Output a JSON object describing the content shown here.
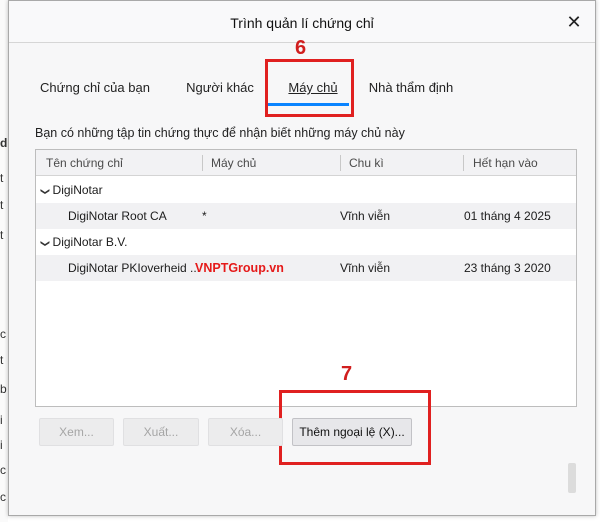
{
  "background_page": {
    "letters": [
      "d",
      "t",
      "t",
      "t",
      "c",
      "t",
      "b",
      "i",
      "i",
      "c",
      "c"
    ]
  },
  "dialog": {
    "title": "Trình quản lí chứng chỉ",
    "close_symbol": "✕"
  },
  "tabs": [
    {
      "label": "Chứng chỉ của bạn",
      "selected": false
    },
    {
      "label": "Người khác",
      "selected": false
    },
    {
      "label": "Máy chủ",
      "selected": true
    },
    {
      "label": "Nhà thẩm định",
      "selected": false
    }
  ],
  "annotations": {
    "step_tab": "6",
    "step_button": "7",
    "watermark": "VNPTGroup.vn",
    "highlight_color": "#e02020"
  },
  "description": "Bạn có những tập tin chứng thực để nhận biết những máy chủ này",
  "table": {
    "columns": [
      "Tên chứng chỉ",
      "Máy chủ",
      "Chu kì",
      "Hết hạn vào"
    ],
    "groups": [
      {
        "name": "DigiNotar",
        "expand_icon": "chevron-down-icon",
        "rows": [
          {
            "name": "DigiNotar Root CA",
            "server": "*",
            "lifetime": "Vĩnh viễn",
            "expires": "01 tháng 4 2025"
          }
        ]
      },
      {
        "name": "DigiNotar B.V.",
        "expand_icon": "chevron-down-icon",
        "rows": [
          {
            "name": "DigiNotar PKIoverheid ...",
            "server": "",
            "lifetime": "Vĩnh viễn",
            "expires": "23 tháng 3 2020"
          }
        ]
      }
    ]
  },
  "buttons": {
    "view": "Xem...",
    "export": "Xuất...",
    "delete": "Xóa...",
    "add_exception": "Thêm ngoại lệ (X)..."
  },
  "colors": {
    "accent": "#0a84ff",
    "annotation": "#d11e1e"
  }
}
